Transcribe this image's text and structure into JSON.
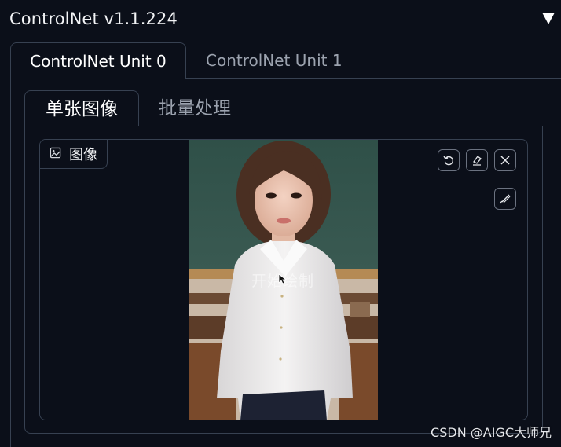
{
  "accordion": {
    "title": "ControlNet v1.1.224",
    "toggle_icon": "triangle-down-icon"
  },
  "unit_tabs": [
    {
      "label": "ControlNet Unit 0",
      "active": true
    },
    {
      "label": "ControlNet Unit 1",
      "active": false
    }
  ],
  "mode_tabs": [
    {
      "label": "单张图像",
      "active": true
    },
    {
      "label": "批量处理",
      "active": false
    }
  ],
  "image_block": {
    "label": "图像",
    "label_icon": "image-icon",
    "tools": [
      "undo-icon",
      "eraser-icon",
      "close-icon",
      "brush-icon"
    ],
    "overlay_text": "开始绘制"
  },
  "watermark": "CSDN @AIGC大师兄",
  "colors": {
    "background": "#0b0f19",
    "border": "#374151",
    "text": "#e5e7eb",
    "muted": "#9ca3af"
  }
}
